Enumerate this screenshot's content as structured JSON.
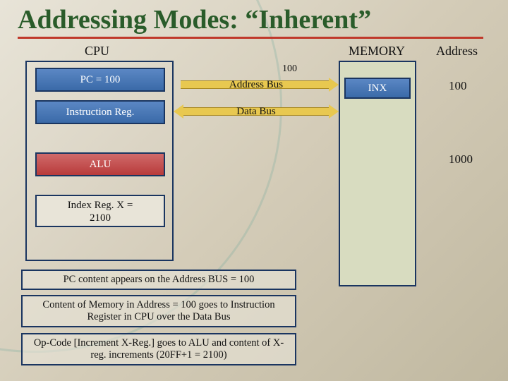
{
  "title": "Addressing Modes: “Inherent”",
  "labels": {
    "cpu": "CPU",
    "memory": "MEMORY",
    "address": "Address",
    "address_bus": "Address Bus",
    "data_bus": "Data Bus",
    "bus_value": "100"
  },
  "cpu": {
    "pc": "PC = 100",
    "ir": "Instruction Reg.",
    "alu": "ALU",
    "index_l1": "Index Reg. X =",
    "index_l2": "2100"
  },
  "memory": {
    "cell1": "INX",
    "addr1": "100",
    "addr2": "1000"
  },
  "captions": {
    "c1": "PC content appears on the Address BUS = 100",
    "c2": "Content of Memory in Address = 100 goes to Instruction Register in CPU over the Data Bus",
    "c3": "Op-Code [Increment X-Reg.] goes to ALU and content of X-reg. increments (20FF+1 = 2100)"
  }
}
